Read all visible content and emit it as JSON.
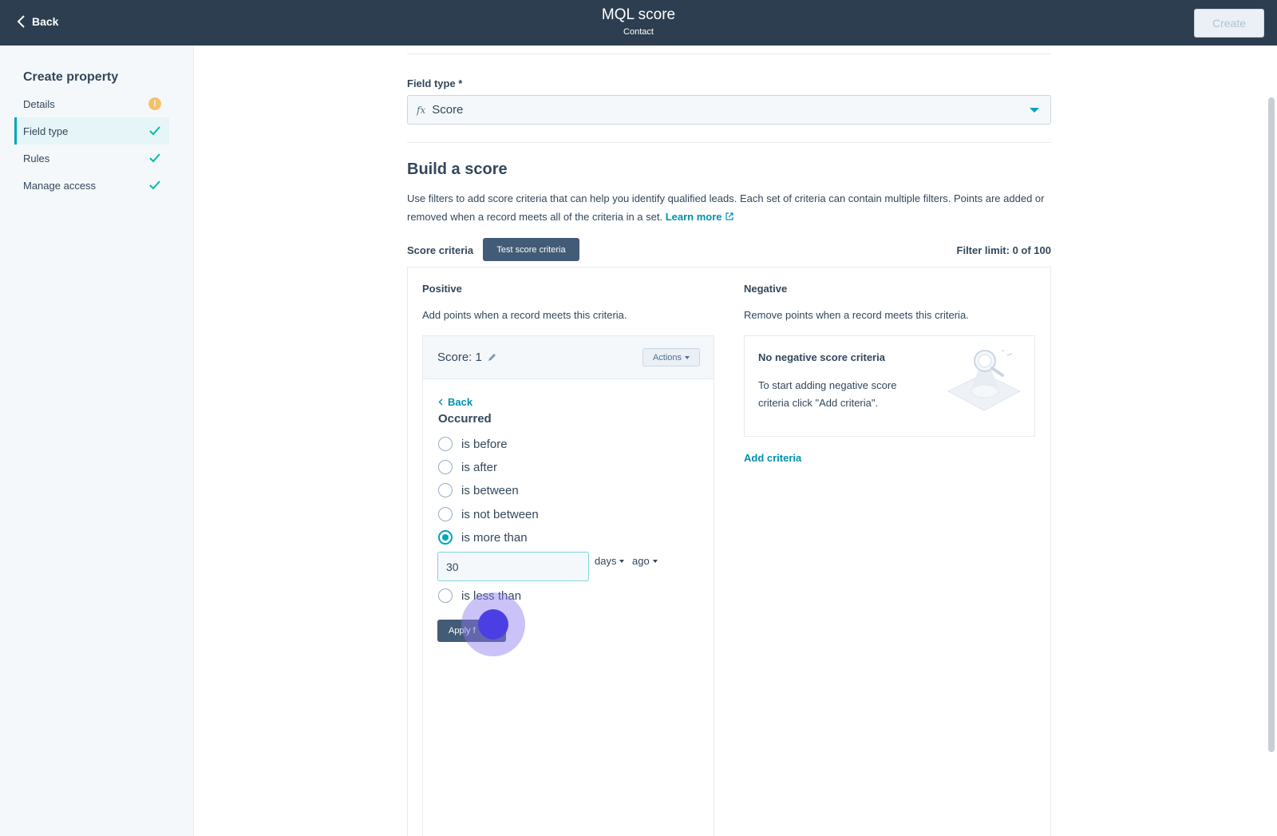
{
  "topbar": {
    "back_label": "Back",
    "title": "MQL score",
    "subtitle": "Contact",
    "create_label": "Create"
  },
  "sidebar": {
    "heading": "Create property",
    "steps": [
      {
        "label": "Details",
        "status": "warning"
      },
      {
        "label": "Field type",
        "status": "complete",
        "active": true
      },
      {
        "label": "Rules",
        "status": "complete"
      },
      {
        "label": "Manage access",
        "status": "complete"
      }
    ]
  },
  "field_type": {
    "label": "Field type *",
    "icon": "fx",
    "value": "Score"
  },
  "build": {
    "title": "Build a score",
    "description": "Use filters to add score criteria that can help you identify qualified leads. Each set of criteria can contain multiple filters. Points are added or removed when a record meets all of the criteria in a set.",
    "learn_more": "Learn more",
    "score_criteria_label": "Score criteria",
    "test_button": "Test score criteria",
    "filter_limit": "Filter limit: 0 of 100"
  },
  "positive": {
    "title": "Positive",
    "subtitle": "Add points when a record meets this criteria.",
    "score_label": "Score: 1",
    "actions_label": "Actions",
    "back_label": "Back",
    "group_title": "Occurred",
    "options": [
      {
        "label": "is before",
        "checked": false
      },
      {
        "label": "is after",
        "checked": false
      },
      {
        "label": "is between",
        "checked": false
      },
      {
        "label": "is not between",
        "checked": false
      },
      {
        "label": "is more than",
        "checked": true
      },
      {
        "label": "is less than",
        "checked": false
      }
    ],
    "number_value": "30",
    "unit_label": "days",
    "direction_label": "ago",
    "apply_label": "Apply f"
  },
  "negative": {
    "title": "Negative",
    "subtitle": "Remove points when a record meets this criteria.",
    "empty_title": "No negative score criteria",
    "empty_text": "To start adding negative score criteria click \"Add criteria\".",
    "add_criteria": "Add criteria"
  },
  "colors": {
    "header_bg": "#2d3e50",
    "accent": "#00a4bd",
    "link": "#0091ae",
    "primary_button": "#425b76",
    "warning": "#f5c26b"
  }
}
